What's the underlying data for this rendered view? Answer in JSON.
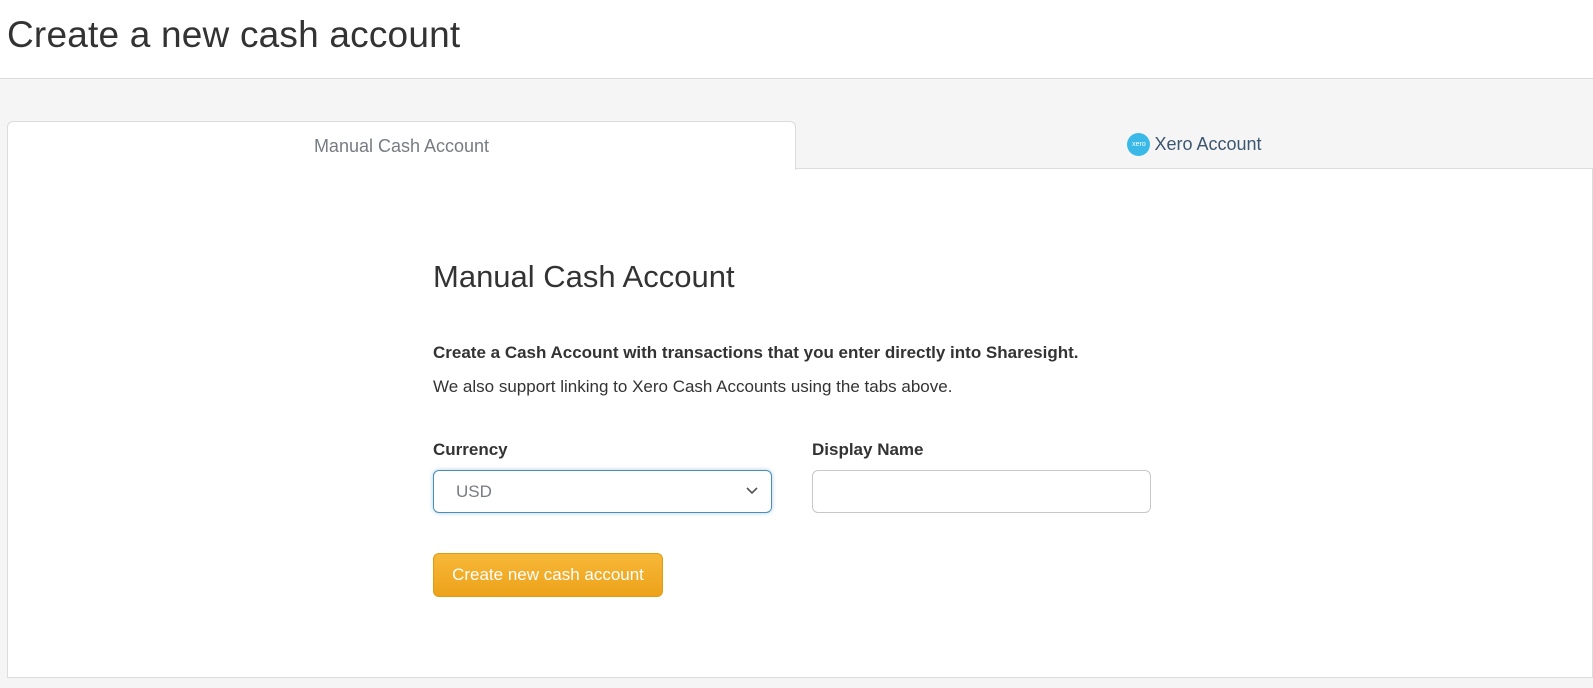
{
  "header": {
    "title": "Create a new cash account"
  },
  "tabs": {
    "manual": {
      "label": "Manual Cash Account",
      "active": true
    },
    "xero": {
      "label": "Xero Account",
      "icon": "xero-logo-icon",
      "icon_text": "xero"
    }
  },
  "form": {
    "title": "Manual Cash Account",
    "intro_bold": "Create a Cash Account with transactions that you enter directly into Sharesight.",
    "intro_text": "We also support linking to Xero Cash Accounts using the tabs above.",
    "currency_label": "Currency",
    "currency_value": "USD",
    "display_name_label": "Display Name",
    "display_name_value": "",
    "submit_label": "Create new cash account"
  },
  "colors": {
    "accent_button": "#eda21a",
    "xero_blue": "#3ab9e8",
    "focus_border": "#4a8fb8"
  }
}
